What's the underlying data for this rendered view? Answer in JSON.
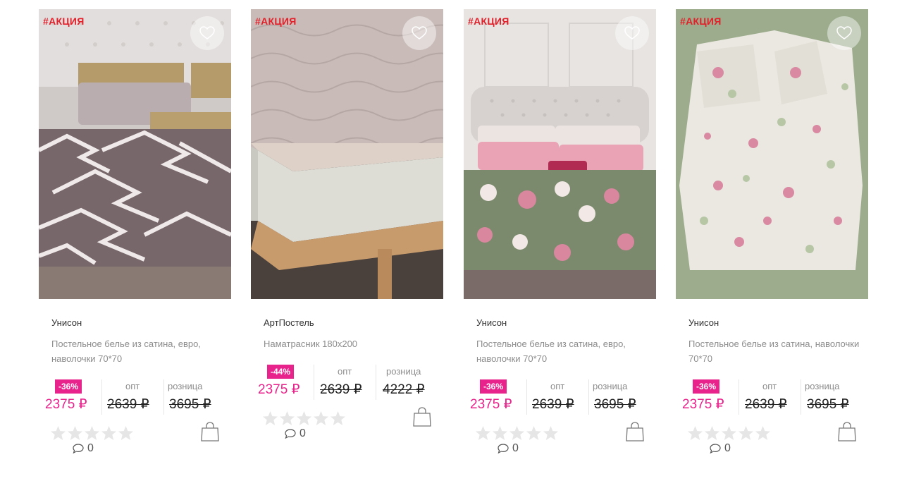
{
  "products": [
    {
      "promo": "#АКЦИЯ",
      "brand": "Унисон",
      "desc": "Постельное белье из сатина, евро, наволочки 70*70",
      "discount": "-36%",
      "price": "2375 ₽",
      "opt_label": "опт",
      "opt_price": "2639 ₽",
      "retail_label": "розница",
      "retail_price": "3695 ₽",
      "rating_count": "0"
    },
    {
      "promo": "#АКЦИЯ",
      "brand": "АртПостель",
      "desc": "Наматрасник 180x200",
      "discount": "-44%",
      "price": "2375 ₽",
      "opt_label": "опт",
      "opt_price": "2639 ₽",
      "retail_label": "розница",
      "retail_price": "4222 ₽",
      "rating_count": "0"
    },
    {
      "promo": "#АКЦИЯ",
      "brand": "Унисон",
      "desc": "Постельное белье из сатина, евро, наволочки 70*70",
      "discount": "-36%",
      "price": "2375 ₽",
      "opt_label": "опт",
      "opt_price": "2639 ₽",
      "retail_label": "розница",
      "retail_price": "3695 ₽",
      "rating_count": "0"
    },
    {
      "promo": "#АКЦИЯ",
      "brand": "Унисон",
      "desc": "Постельное белье из сатина, наволочки 70*70",
      "discount": "-36%",
      "price": "2375 ₽",
      "opt_label": "опт",
      "opt_price": "2639 ₽",
      "retail_label": "розница",
      "retail_price": "3695 ₽",
      "rating_count": "0"
    }
  ],
  "icons": {
    "favorite": "heart-icon",
    "cart": "shopping-bag-icon",
    "comments": "speech-bubble-icon",
    "rating": "star-icon"
  },
  "colors": {
    "promo": "#e3202a",
    "accent": "#e8238c",
    "star_empty": "#e6e6e6"
  }
}
